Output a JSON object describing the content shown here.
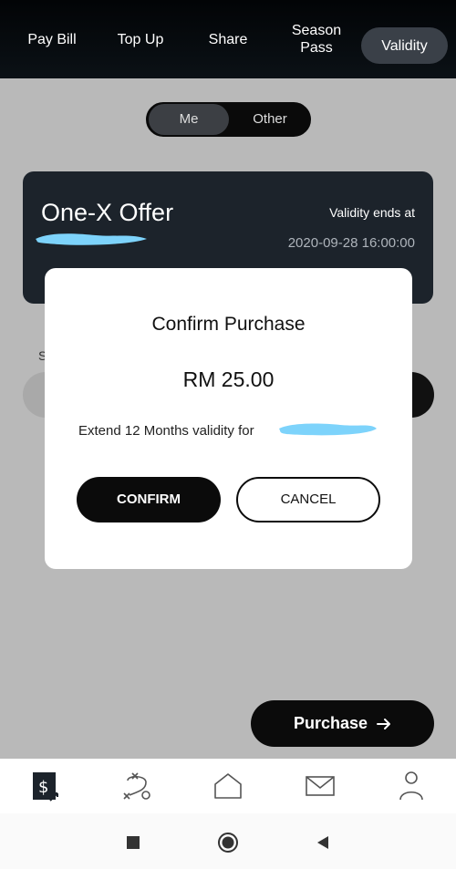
{
  "nav": {
    "tabs": [
      {
        "label": "Pay Bill"
      },
      {
        "label": "Top Up"
      },
      {
        "label": "Share"
      },
      {
        "label": "Season\nPass"
      },
      {
        "label": "Validity"
      }
    ],
    "active_tab": "Validity"
  },
  "toggle": {
    "me": "Me",
    "other": "Other",
    "selected": "Me"
  },
  "offer_card": {
    "title": "One-X Offer",
    "validity_label": "Validity ends at",
    "validity_date": "2020-09-28 16:00:00"
  },
  "behind_modal": {
    "fragment": "S"
  },
  "modal": {
    "title": "Confirm Purchase",
    "amount": "RM 25.00",
    "description": "Extend 12 Months validity for",
    "confirm_label": "CONFIRM",
    "cancel_label": "CANCEL"
  },
  "purchase_button": {
    "label": "Purchase",
    "icon": "arrow-right-icon"
  },
  "bottom_nav": {
    "icons": [
      "bill-icon",
      "strategy-icon",
      "home-icon",
      "mail-icon",
      "profile-icon"
    ]
  },
  "system_nav": {
    "icons": [
      "recent-apps-icon",
      "home-circle-icon",
      "back-icon"
    ]
  },
  "colors": {
    "scribble": "#7dd3fb",
    "accent_dark": "#0b0b0b"
  }
}
